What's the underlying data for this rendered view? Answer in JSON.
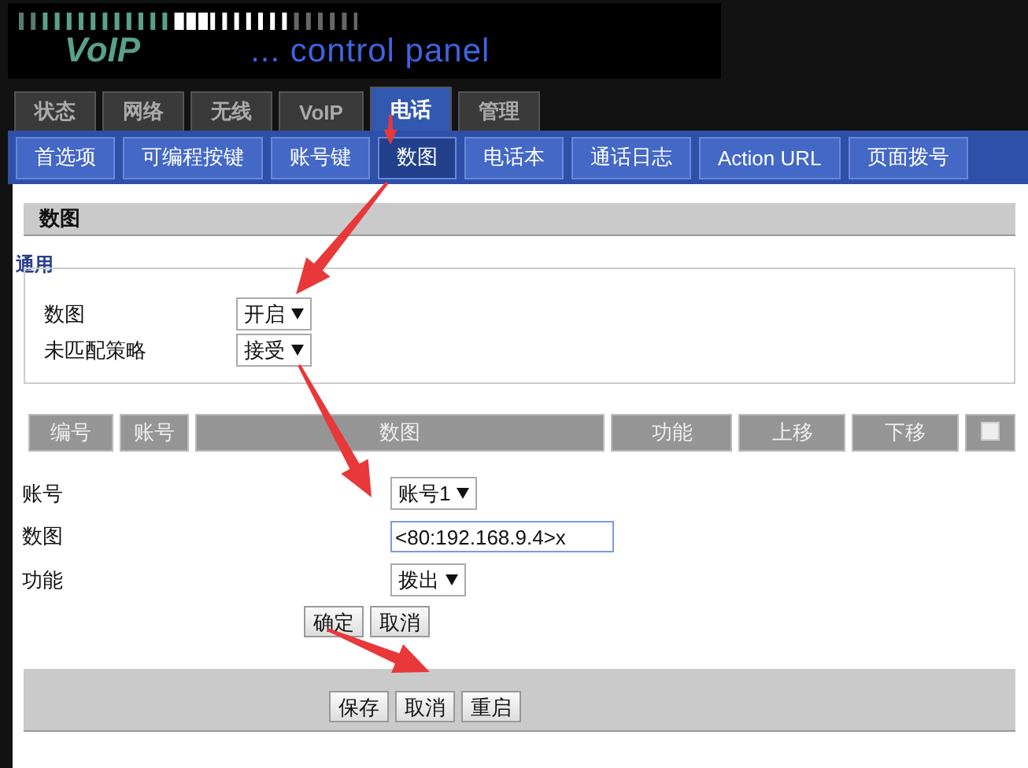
{
  "header": {
    "logo": "VoIP",
    "tagline": "... control panel"
  },
  "main_tabs": [
    {
      "label": "状态",
      "selected": false
    },
    {
      "label": "网络",
      "selected": false
    },
    {
      "label": "无线",
      "selected": false
    },
    {
      "label": "VoIP",
      "selected": false
    },
    {
      "label": "电话",
      "selected": true
    },
    {
      "label": "管理",
      "selected": false
    }
  ],
  "sub_tabs": [
    {
      "label": "首选项",
      "selected": false
    },
    {
      "label": "可编程按键",
      "selected": false
    },
    {
      "label": "账号键",
      "selected": false
    },
    {
      "label": "数图",
      "selected": true
    },
    {
      "label": "电话本",
      "selected": false
    },
    {
      "label": "通话日志",
      "selected": false
    },
    {
      "label": "Action URL",
      "selected": false
    },
    {
      "label": "页面拨号",
      "selected": false
    }
  ],
  "section_title": "数图",
  "general": {
    "legend": "通用",
    "fields": [
      {
        "label": "数图",
        "value": "开启"
      },
      {
        "label": "未匹配策略",
        "value": "接受"
      }
    ]
  },
  "table": {
    "columns": [
      "编号",
      "账号",
      "数图",
      "功能",
      "上移",
      "下移"
    ],
    "select_all_checked": false
  },
  "form": {
    "fields": [
      {
        "kind": "select",
        "label": "账号",
        "value": "账号1"
      },
      {
        "kind": "input",
        "label": "数图",
        "value": "<80:192.168.9.4>x"
      },
      {
        "kind": "select",
        "label": "功能",
        "value": "拨出"
      }
    ],
    "buttons": [
      "确定",
      "取消"
    ]
  },
  "footer_buttons": [
    "保存",
    "取消",
    "重启"
  ]
}
